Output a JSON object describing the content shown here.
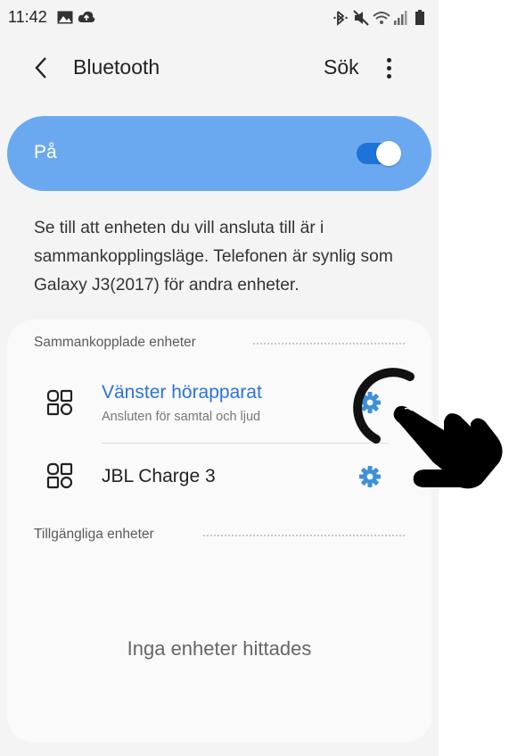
{
  "status_bar": {
    "time": "11:42",
    "left_icons": [
      "gallery-icon",
      "cloud-icon"
    ],
    "right_icons": [
      "bluetooth-icon",
      "mute-icon",
      "wifi-icon",
      "signal-icon",
      "battery-icon"
    ]
  },
  "header": {
    "title": "Bluetooth",
    "search_label": "Sök"
  },
  "bluetooth_toggle": {
    "label": "På",
    "on": true,
    "accent": "#6aa9f0",
    "switch_color": "#1e73d9"
  },
  "description": "Se till att enheten du vill ansluta till är i sammankopplingsläge. Telefonen är synlig som Galaxy J3(2017) för andra enheter.",
  "paired": {
    "title": "Sammankopplade enheter",
    "devices": [
      {
        "name": "Vänster hörapparat",
        "status": "Ansluten för samtal och ljud",
        "name_color": "#2b74d6"
      },
      {
        "name": "JBL Charge 3",
        "name_color": "#222222"
      }
    ]
  },
  "available": {
    "title": "Tillgängliga enheter",
    "empty_text": "Inga enheter hittades"
  },
  "gear_color": "#3f8fd9"
}
